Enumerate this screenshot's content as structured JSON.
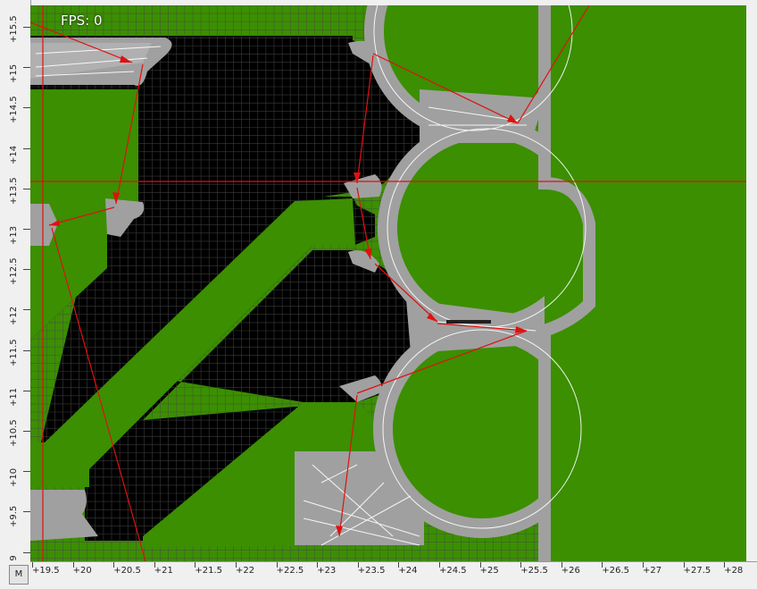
{
  "fps_label": "FPS: 0",
  "mode_button": "M",
  "colors": {
    "copper": "#3b8f00",
    "clearance": "#a0a0a0",
    "board": "#000000",
    "grid": "#555555",
    "route": "#e01010",
    "trace_lines": "#ffffff"
  },
  "y_ruler": [
    "+15.5",
    "+15",
    "+14.5",
    "+14",
    "+13.5",
    "+13",
    "+12.5",
    "+12",
    "+11.5",
    "+11",
    "+10.5",
    "+10",
    "+9.5",
    "+9"
  ],
  "x_ruler": [
    "+19.5",
    "+20",
    "+20.5",
    "+21",
    "+21.5",
    "+22",
    "+22.5",
    "+23",
    "+23.5",
    "+24",
    "+24.5",
    "+25",
    "+25.5",
    "+26",
    "+26.5",
    "+27",
    "+27.5",
    "+28"
  ]
}
